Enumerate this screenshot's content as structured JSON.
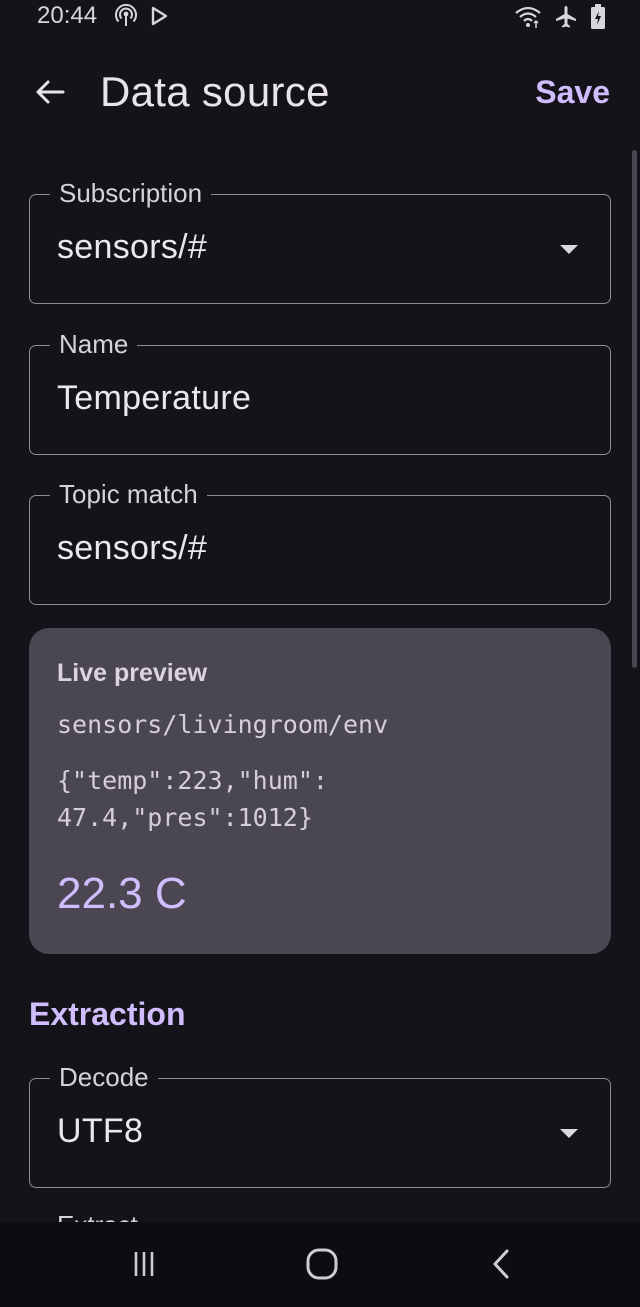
{
  "status_bar": {
    "time": "20:44",
    "left_icons": [
      "hotspot-icon",
      "play-icon"
    ],
    "right_icons": [
      "wifi-icon",
      "airplane-mode-icon",
      "battery-charging-icon"
    ]
  },
  "app_bar": {
    "back_icon": "arrow-left-icon",
    "title": "Data source",
    "save_label": "Save"
  },
  "form": {
    "subscription": {
      "label": "Subscription",
      "value": "sensors/#"
    },
    "name": {
      "label": "Name",
      "value": "Temperature"
    },
    "topic_match": {
      "label": "Topic match",
      "value": "sensors/#"
    }
  },
  "preview": {
    "heading": "Live preview",
    "topic": "sensors/livingroom/env",
    "payload_lines": [
      "{\"temp\":223,\"hum\":",
      "47.4,\"pres\":1012}"
    ],
    "value": "22.3 C"
  },
  "extraction": {
    "header": "Extraction",
    "decode": {
      "label": "Decode",
      "value": "UTF8"
    },
    "next_label": "Extract"
  },
  "nav_bar": {
    "buttons": [
      "recent-apps-icon",
      "home-icon",
      "back-icon"
    ]
  },
  "colors": {
    "background": "#15131a",
    "accent": "#cfbdfd",
    "card": "#4a4652",
    "outline": "#8e8a93"
  }
}
